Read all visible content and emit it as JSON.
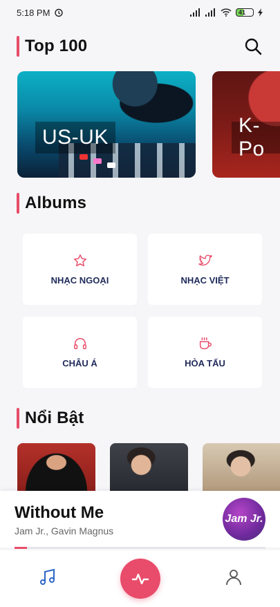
{
  "status_bar": {
    "time": "5:18 PM",
    "battery": "41"
  },
  "sections": {
    "top100_title": "Top 100",
    "albums_title": "Albums",
    "featured_title": "Nổi Bật"
  },
  "top100_cards": [
    {
      "label": "US-UK"
    },
    {
      "label": "K-Po"
    }
  ],
  "albums": [
    {
      "label": "NHẠC NGOẠI",
      "icon": "star-icon"
    },
    {
      "label": "NHẠC VIỆT",
      "icon": "twitter-bird-icon"
    },
    {
      "label": "CHÂU Á",
      "icon": "headphones-icon"
    },
    {
      "label": "HÒA TẤU",
      "icon": "coffee-cup-icon"
    }
  ],
  "now_playing": {
    "title": "Without Me",
    "artist": "Jam Jr., Gavin Magnus",
    "cover_text": "Jam Jr.",
    "progress": 0.05
  },
  "colors": {
    "accent": "#e84c6a",
    "album_text": "#1f2a5a",
    "nav_active": "#2a65c7"
  },
  "bottom_nav": {
    "items": [
      "music-note-icon",
      "activity-pulse-icon",
      "user-icon"
    ]
  }
}
